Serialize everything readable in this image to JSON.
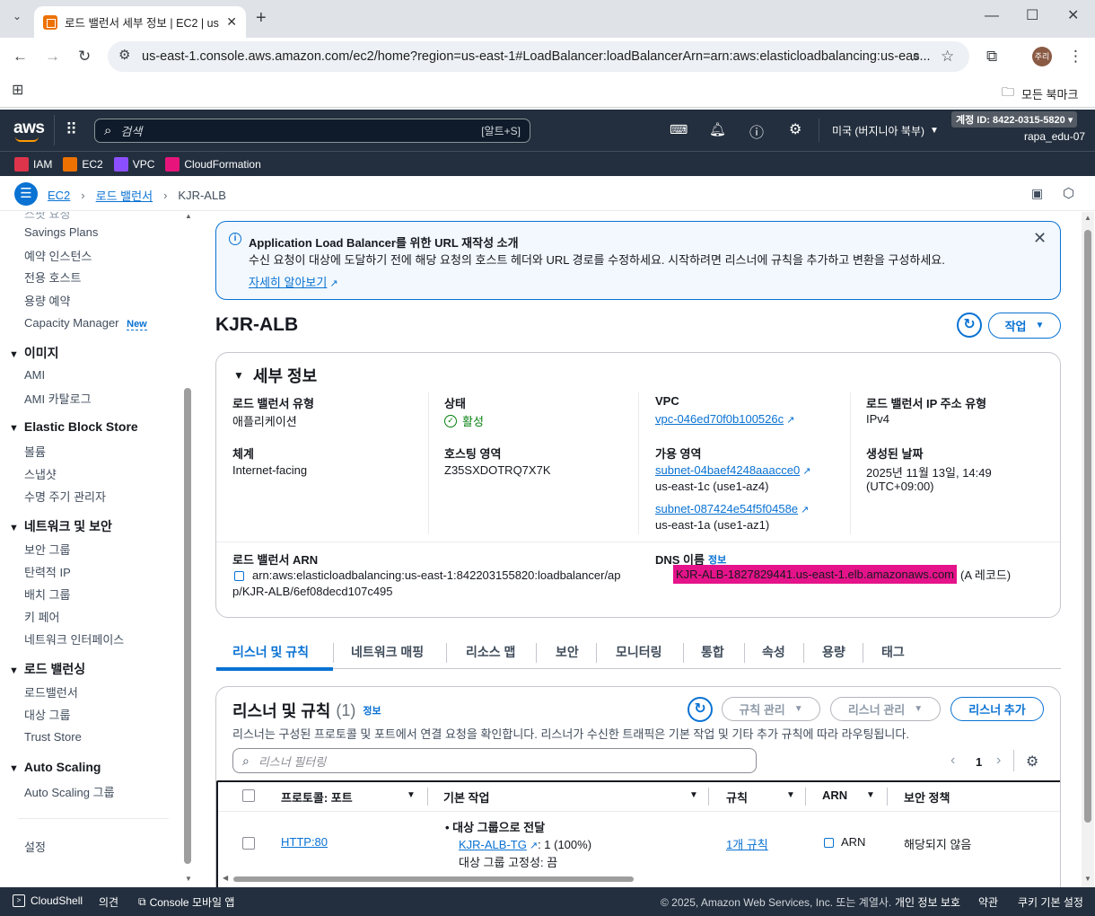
{
  "browser": {
    "tab_title": "로드 밸런서 세부 정보 | EC2 | us",
    "url": "us-east-1.console.aws.amazon.com/ec2/home?region=us-east-1#LoadBalancer:loadBalancerArn=arn:aws:elasticloadbalancing:us-eas...",
    "profile": "주리",
    "bookmarks_label": "모든 북마크"
  },
  "aws_header": {
    "logo": "aws",
    "search_placeholder": "검색",
    "search_shortcut": "[알트+S]",
    "region": "미국 (버지니아 북부)",
    "account_id": "계정 ID: 8422-0315-5820",
    "user": "rapa_edu-07",
    "favorites": [
      "IAM",
      "EC2",
      "VPC",
      "CloudFormation"
    ],
    "favorite_colors": [
      "#dd344c",
      "#ed7100",
      "#8c4fff",
      "#e7157b"
    ]
  },
  "breadcrumb": [
    "EC2",
    "로드 밸런서",
    "KJR-ALB"
  ],
  "sidebar": {
    "partial_top": "스팟 요청",
    "items_a": [
      "Savings Plans",
      "예약 인스턴스",
      "전용 호스트",
      "용량 예약"
    ],
    "capacity_manager": "Capacity Manager",
    "new_badge": "New",
    "sections": [
      {
        "title": "이미지",
        "items": [
          "AMI",
          "AMI 카탈로그"
        ]
      },
      {
        "title": "Elastic Block Store",
        "items": [
          "볼륨",
          "스냅샷",
          "수명 주기 관리자"
        ]
      },
      {
        "title": "네트워크 및 보안",
        "items": [
          "보안 그룹",
          "탄력적 IP",
          "배치 그룹",
          "키 페어",
          "네트워크 인터페이스"
        ]
      },
      {
        "title": "로드 밸런싱",
        "items": [
          "로드밸런서",
          "대상 그룹",
          "Trust Store"
        ]
      },
      {
        "title": "Auto Scaling",
        "items": [
          "Auto Scaling 그룹"
        ]
      }
    ],
    "settings": "설정"
  },
  "info_banner": {
    "title": "Application Load Balancer를 위한 URL 재작성 소개",
    "body": "수신 요청이 대상에 도달하기 전에 해당 요청의 호스트 헤더와 URL 경로를 수정하세요. 시작하려면 리스너에 규칙을 추가하고 변환을 구성하세요.",
    "link": "자세히 알아보기"
  },
  "page": {
    "title": "KJR-ALB",
    "action_button": "작업"
  },
  "details": {
    "heading": "세부 정보",
    "lb_type_label": "로드 밸런서 유형",
    "lb_type": "애플리케이션",
    "scheme_label": "체계",
    "scheme": "Internet-facing",
    "state_label": "상태",
    "state": "활성",
    "hosted_zone_label": "호스팅 영역",
    "hosted_zone": "Z35SXDOTRQ7X7K",
    "vpc_label": "VPC",
    "vpc": "vpc-046ed70f0b100526c",
    "az_label": "가용 영역",
    "subnet1": "subnet-04baef4248aaacce0",
    "subnet1_az": "us-east-1c (use1-az4)",
    "subnet2": "subnet-087424e54f5f0458e",
    "subnet2_az": "us-east-1a (use1-az1)",
    "ip_type_label": "로드 밸런서 IP 주소 유형",
    "ip_type": "IPv4",
    "created_label": "생성된 날짜",
    "created": "2025년 11월 13일, 14:49",
    "created_tz": "(UTC+09:00)",
    "arn_label": "로드 밸런서 ARN",
    "arn_line1": "arn:aws:elasticloadbalancing:us-east-1:842203155820:loadbalancer/ap",
    "arn_line2": "p/KJR-ALB/6ef08decd107c495",
    "dns_label": "DNS 이름",
    "dns_info": "정보",
    "dns": "KJR-ALB-1827829441.us-east-1.elb.amazonaws.com",
    "dns_suffix": "(A 레코드)"
  },
  "tabs": [
    "리스너 및 규칙",
    "네트워크 매핑",
    "리소스 맵",
    "보안",
    "모니터링",
    "통합",
    "속성",
    "용량",
    "태그"
  ],
  "listeners": {
    "title": "리스너 및 규칙",
    "count": "(1)",
    "info": "정보",
    "description": "리스너는 구성된 프로토콜 및 포트에서 연결 요청을 확인합니다. 리스너가 수신한 트래픽은 기본 작업 및 기타 추가 규칙에 따라 라우팅됩니다.",
    "manage_rules": "규칙 관리",
    "manage_listeners": "리스너 관리",
    "add_listener": "리스너 추가",
    "filter_placeholder": "리스너 필터링",
    "page": "1",
    "columns": [
      "프로토콜: 포트",
      "기본 작업",
      "규칙",
      "ARN",
      "보안 정책"
    ],
    "row": {
      "protocol": "HTTP:80",
      "action_title": "대상 그룹으로 전달",
      "target_group": "KJR-ALB-TG",
      "weight": ": 1 (100%)",
      "stickiness": "대상 그룹 고정성: 끔",
      "rules": "1개 규칙",
      "arn": "ARN",
      "security_policy": "해당되지 않음"
    }
  },
  "footer": {
    "cloudshell": "CloudShell",
    "feedback": "의견",
    "mobile": "Console 모바일 앱",
    "copyright": "© 2025, Amazon Web Services, Inc. 또는 계열사.",
    "privacy": "개인 정보 보호",
    "terms": "약관",
    "cookies": "쿠키 기본 설정"
  }
}
